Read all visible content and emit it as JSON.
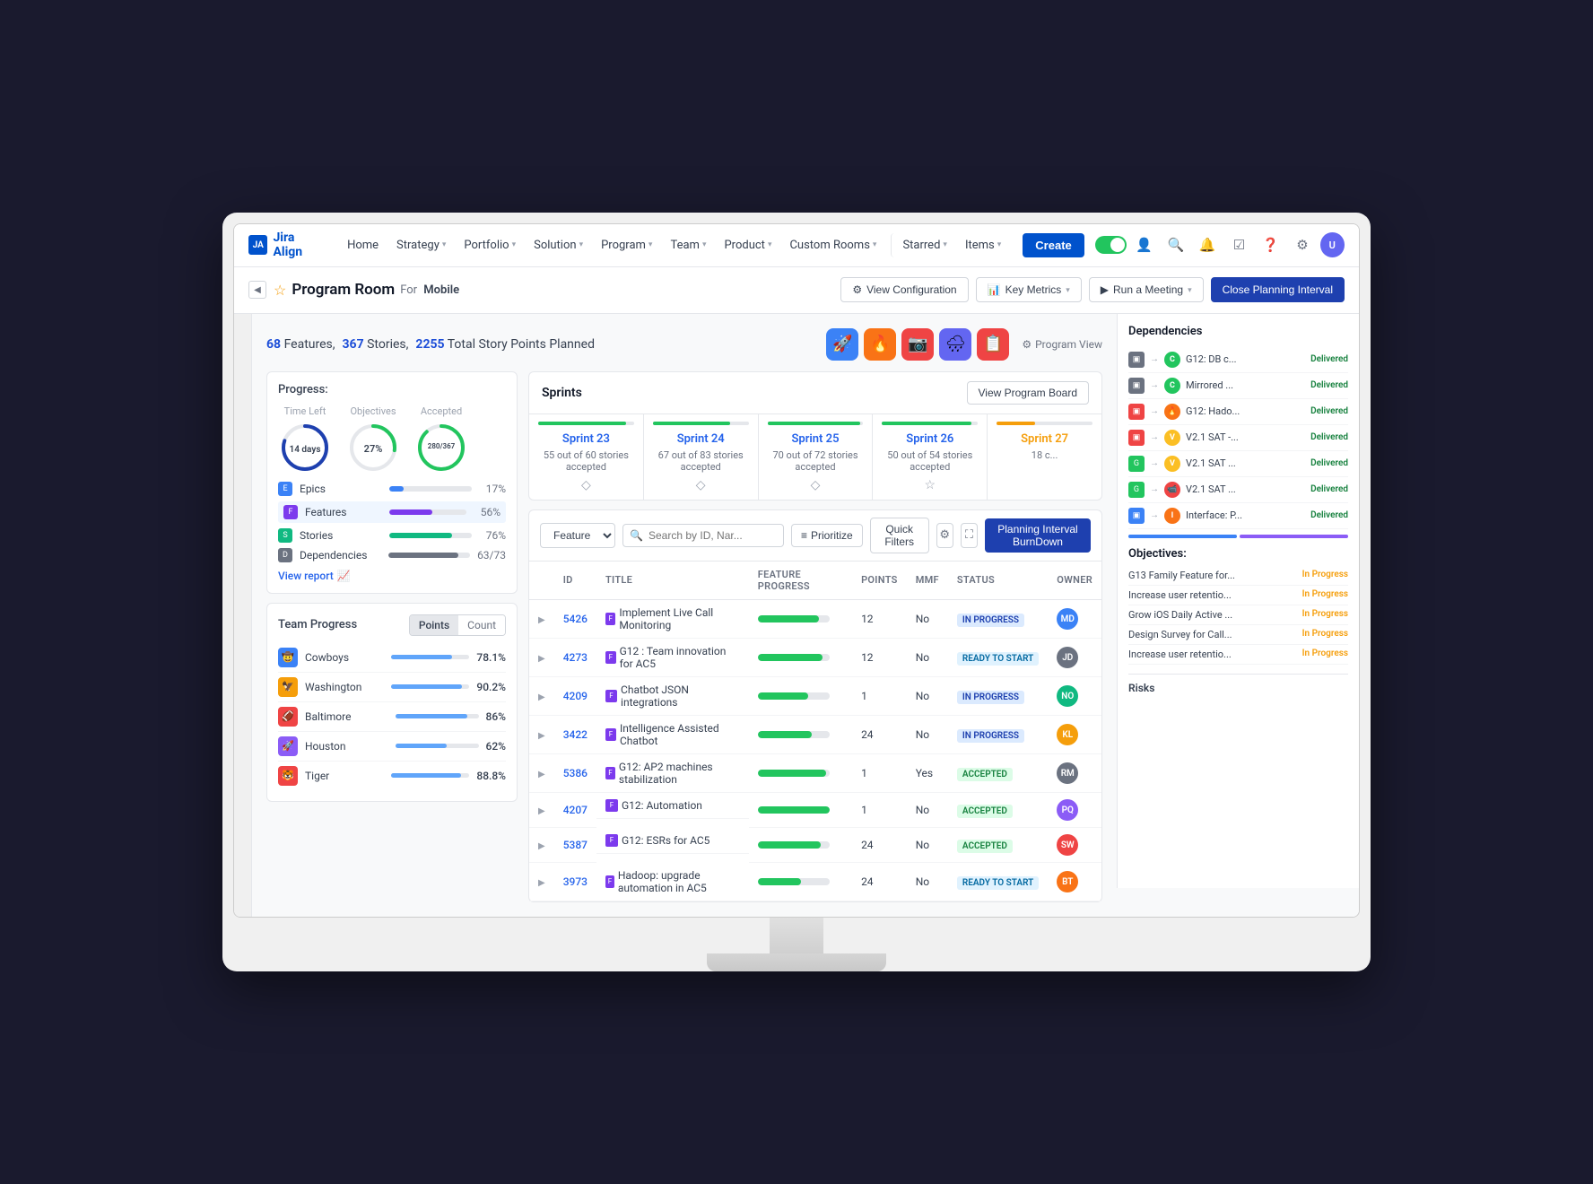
{
  "app": {
    "logo": "JA",
    "name": "Jira Align"
  },
  "nav": {
    "items": [
      {
        "label": "Home",
        "has_dropdown": false
      },
      {
        "label": "Strategy",
        "has_dropdown": true
      },
      {
        "label": "Portfolio",
        "has_dropdown": true
      },
      {
        "label": "Solution",
        "has_dropdown": true
      },
      {
        "label": "Program",
        "has_dropdown": true
      },
      {
        "label": "Team",
        "has_dropdown": true
      },
      {
        "label": "Product",
        "has_dropdown": true
      },
      {
        "label": "Custom Rooms",
        "has_dropdown": true
      },
      {
        "label": "Starred",
        "has_dropdown": true
      },
      {
        "label": "Items",
        "has_dropdown": true
      }
    ],
    "create_label": "Create"
  },
  "sub_header": {
    "page_title": "Program Room",
    "for_label": "For",
    "workspace": "Mobile",
    "actions": [
      {
        "label": "View Configuration",
        "icon": "⚙"
      },
      {
        "label": "Key Metrics",
        "icon": "📊",
        "has_dropdown": true
      },
      {
        "label": "Run a Meeting",
        "icon": "▶",
        "has_dropdown": true
      },
      {
        "label": "Close Planning Interval",
        "is_primary": true
      }
    ]
  },
  "stats": {
    "features_count": "68",
    "stories_count": "367",
    "points_total": "2255",
    "features_label": "Features,",
    "stories_label": "Stories,",
    "points_label": "Total Story Points Planned",
    "program_view_label": "Program View"
  },
  "progress": {
    "title": "Progress:",
    "time_left": {
      "label": "Time Left",
      "value": "14 days"
    },
    "objectives": {
      "label": "Objectives",
      "pct": 27
    },
    "accepted": {
      "label": "Accepted",
      "value": "280/367"
    },
    "items": [
      {
        "icon": "E",
        "color": "#3b82f6",
        "label": "Epics",
        "pct": 17,
        "bar_color": "#3b82f6"
      },
      {
        "icon": "F",
        "color": "#7c3aed",
        "label": "Features",
        "pct": 56,
        "bar_color": "#7c3aed"
      },
      {
        "icon": "S",
        "color": "#10b981",
        "label": "Stories",
        "pct": 76,
        "bar_color": "#10b981"
      },
      {
        "icon": "D",
        "color": "#6b7280",
        "label": "Dependencies",
        "pct_label": "63/73",
        "pct": 86,
        "bar_color": "#6b7280"
      }
    ],
    "view_report": "View report"
  },
  "team_progress": {
    "title": "Team Progress",
    "tabs": [
      "Points",
      "Count"
    ],
    "active_tab": "Points",
    "teams": [
      {
        "icon": "🤠",
        "color": "#3b82f6",
        "name": "Cowboys",
        "pct": "78.1%",
        "bar_pct": 78
      },
      {
        "icon": "🦅",
        "color": "#f59e0b",
        "name": "Washington",
        "pct": "90.2%",
        "bar_pct": 90
      },
      {
        "icon": "🏈",
        "color": "#ef4444",
        "name": "Baltimore",
        "pct": "86%",
        "bar_pct": 86
      },
      {
        "icon": "🚀",
        "color": "#8b5cf6",
        "name": "Houston",
        "pct": "62%",
        "bar_pct": 62
      },
      {
        "icon": "🐯",
        "color": "#ef4444",
        "name": "Tiger",
        "pct": "88.8%",
        "bar_pct": 89
      }
    ]
  },
  "sprints": {
    "title": "Sprints",
    "view_board_label": "View Program Board",
    "items": [
      {
        "name": "Sprint 23",
        "sub": "55 out of 60 stories accepted",
        "progress": 92,
        "color": "#22c55e"
      },
      {
        "name": "Sprint 24",
        "sub": "67 out of 83 stories accepted",
        "progress": 81,
        "color": "#22c55e"
      },
      {
        "name": "Sprint 25",
        "sub": "70 out of 72 stories accepted",
        "progress": 97,
        "color": "#22c55e"
      },
      {
        "name": "Sprint 26",
        "sub": "50 out of 54 stories accepted",
        "progress": 93,
        "color": "#22c55e"
      },
      {
        "name": "Sprint 27",
        "sub": "18 c...",
        "progress": 40,
        "color": "#f59e0b"
      }
    ]
  },
  "features_table": {
    "filter_placeholder": "Feature",
    "search_placeholder": "Search by ID, Nar...",
    "toolbar": {
      "prioritize": "Prioritize",
      "quick_filters": "Quick Filters",
      "planning_burndown": "Planning Interval BurnDown"
    },
    "columns": [
      "ID",
      "Title",
      "Feature Progress",
      "Points",
      "MMF",
      "Status",
      "Owner"
    ],
    "rows": [
      {
        "id": "5426",
        "title": "Implement Live Call Monitoring",
        "progress": 85,
        "points": 12,
        "mmf": "No",
        "status": "IN PROGRESS",
        "status_class": "status-in-progress",
        "owner_color": "#3b82f6",
        "owner_initials": "MD"
      },
      {
        "id": "4273",
        "title": "G12 : Team innovation for AC5",
        "progress": 90,
        "points": 12,
        "mmf": "No",
        "status": "READY TO START",
        "status_class": "status-ready-to-start",
        "owner_color": "#6b7280",
        "owner_initials": "JD"
      },
      {
        "id": "4209",
        "title": "Chatbot JSON integrations",
        "progress": 70,
        "points": 1,
        "mmf": "No",
        "status": "IN PROGRESS",
        "status_class": "status-in-progress",
        "owner_color": "#10b981",
        "owner_initials": "NO"
      },
      {
        "id": "3422",
        "title": "Intelligence Assisted Chatbot",
        "progress": 75,
        "points": 24,
        "mmf": "No",
        "status": "IN PROGRESS",
        "status_class": "status-in-progress",
        "owner_color": "#f59e0b",
        "owner_initials": "KL"
      },
      {
        "id": "5386",
        "title": "G12: AP2 machines stabilization",
        "progress": 95,
        "points": 1,
        "mmf": "Yes",
        "status": "ACCEPTED",
        "status_class": "status-accepted",
        "owner_color": "#6b7280",
        "owner_initials": "RM"
      },
      {
        "id": "4207",
        "title": "G12: Automation",
        "progress": 100,
        "points": 1,
        "mmf": "No",
        "status": "ACCEPTED",
        "status_class": "status-accepted",
        "owner_color": "#8b5cf6",
        "owner_initials": "PQ"
      },
      {
        "id": "5387",
        "title": "G12: ESRs for AC5",
        "progress": 88,
        "points": 24,
        "mmf": "No",
        "status": "ACCEPTED",
        "status_class": "status-accepted",
        "owner_color": "#ef4444",
        "owner_initials": "SW"
      },
      {
        "id": "3973",
        "title": "Hadoop: upgrade automation in AC5",
        "progress": 60,
        "points": 24,
        "mmf": "No",
        "status": "READY TO START",
        "status_class": "status-ready-to-start",
        "owner_color": "#f97316",
        "owner_initials": "BT"
      }
    ]
  },
  "dependencies": {
    "title": "Dependencies",
    "items": [
      {
        "left_color": "#6b7280",
        "right_color": "#22c55e",
        "right_text": "Cha",
        "text": "G12: DB c...",
        "status": "Delivered"
      },
      {
        "left_color": "#6b7280",
        "right_color": "#22c55e",
        "right_text": "Cha",
        "text": "Mirrored ...",
        "status": "Delivered"
      },
      {
        "left_color": "#ef4444",
        "right_color": "#f97316",
        "right_text": "🔥",
        "text": "G12: Hado...",
        "status": "Delivered"
      },
      {
        "left_color": "#ef4444",
        "right_color": "#fbbf24",
        "right_text": "V",
        "text": "V2.1 SAT -...",
        "status": "Delivered"
      },
      {
        "left_color": "#22c55e",
        "right_color": "#fbbf24",
        "right_text": "V",
        "text": "V2.1 SAT ...",
        "status": "Delivered"
      },
      {
        "left_color": "#22c55e",
        "right_color": "#ef4444",
        "right_text": "📹",
        "text": "V2.1 SAT ...",
        "status": "Delivered"
      },
      {
        "left_color": "#3b82f6",
        "right_color": "#f97316",
        "right_text": "I",
        "text": "Interface: P...",
        "status": "Delivered"
      }
    ]
  },
  "objectives": {
    "title": "Objectives:",
    "items": [
      {
        "text": "G13 Family Feature for...",
        "status": "In Progress"
      },
      {
        "text": "Increase user retentio...",
        "status": "In Progress"
      },
      {
        "text": "Grow iOS Daily Active ...",
        "status": "In Progress"
      },
      {
        "text": "Design Survey for Call...",
        "status": "In Progress"
      },
      {
        "text": "Increase user retentio...",
        "status": "In Progress"
      }
    ]
  }
}
